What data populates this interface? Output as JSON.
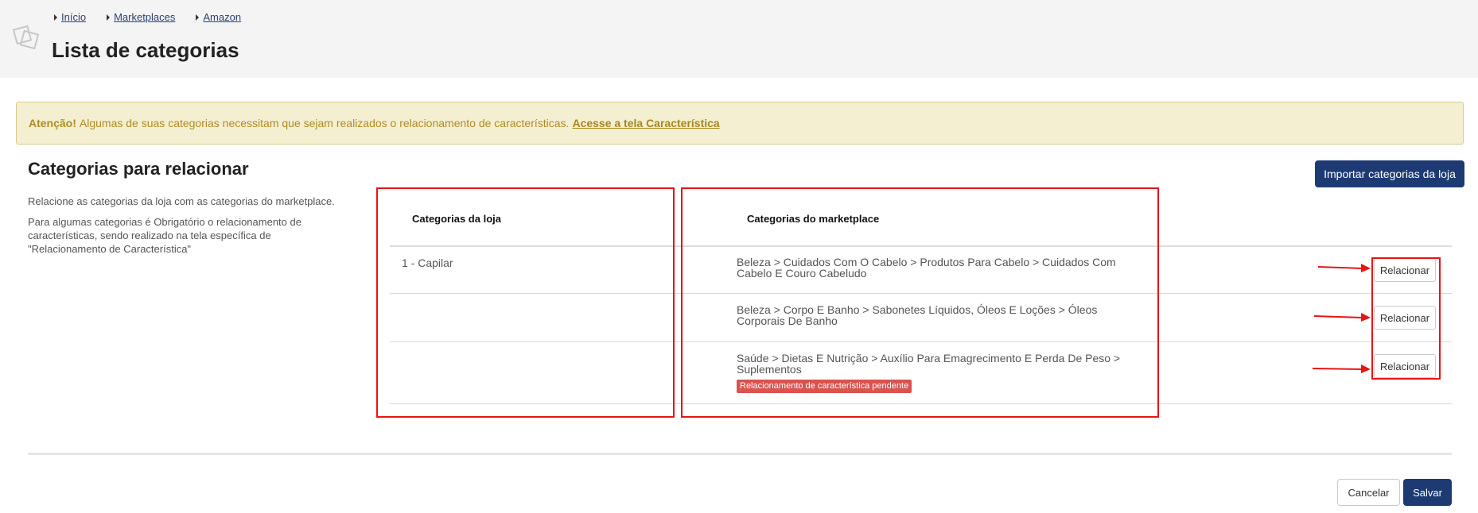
{
  "breadcrumb": [
    {
      "label": "Início"
    },
    {
      "label": "Marketplaces"
    },
    {
      "label": "Amazon"
    }
  ],
  "page_title": "Lista de categorias",
  "alert": {
    "strong": "Atenção!",
    "text": "Algumas de suas categorias necessitam que sejam realizados o relacionamento de características.",
    "link": "Acesse a tela Característica"
  },
  "section": {
    "title": "Categorias para relacionar",
    "description": "Relacione as categorias da loja com as categorias do marketplace.",
    "note": "Para algumas categorias é Obrigatório o relacionamento de características, sendo realizado na tela específica de \"Relacionamento de Característica\""
  },
  "import_button": "Importar categorias da loja",
  "table": {
    "headers": {
      "store": "Categorias da loja",
      "marketplace": "Categorias do marketplace"
    },
    "store_category": "1 - Capilar",
    "rows": [
      {
        "marketplace": "Beleza > Cuidados Com O Cabelo > Produtos Para Cabelo > Cuidados Com Cabelo E Couro Cabeludo",
        "badge": "",
        "action": "Relacionar"
      },
      {
        "marketplace": "Beleza > Corpo E Banho > Sabonetes Líquidos, Óleos E Loções > Óleos Corporais De Banho",
        "badge": "",
        "action": "Relacionar"
      },
      {
        "marketplace": "Saúde > Dietas E Nutrição > Auxílio Para Emagrecimento E Perda De Peso > Suplementos",
        "badge": "Relacionamento de característica pendente",
        "action": "Relacionar"
      }
    ]
  },
  "footer": {
    "cancel": "Cancelar",
    "save": "Salvar"
  },
  "colors": {
    "primary": "#1d3a73",
    "alert_bg": "#f5efd1",
    "alert_text": "#b08b24",
    "annotation": "#e81515",
    "badge": "#d9534f"
  }
}
